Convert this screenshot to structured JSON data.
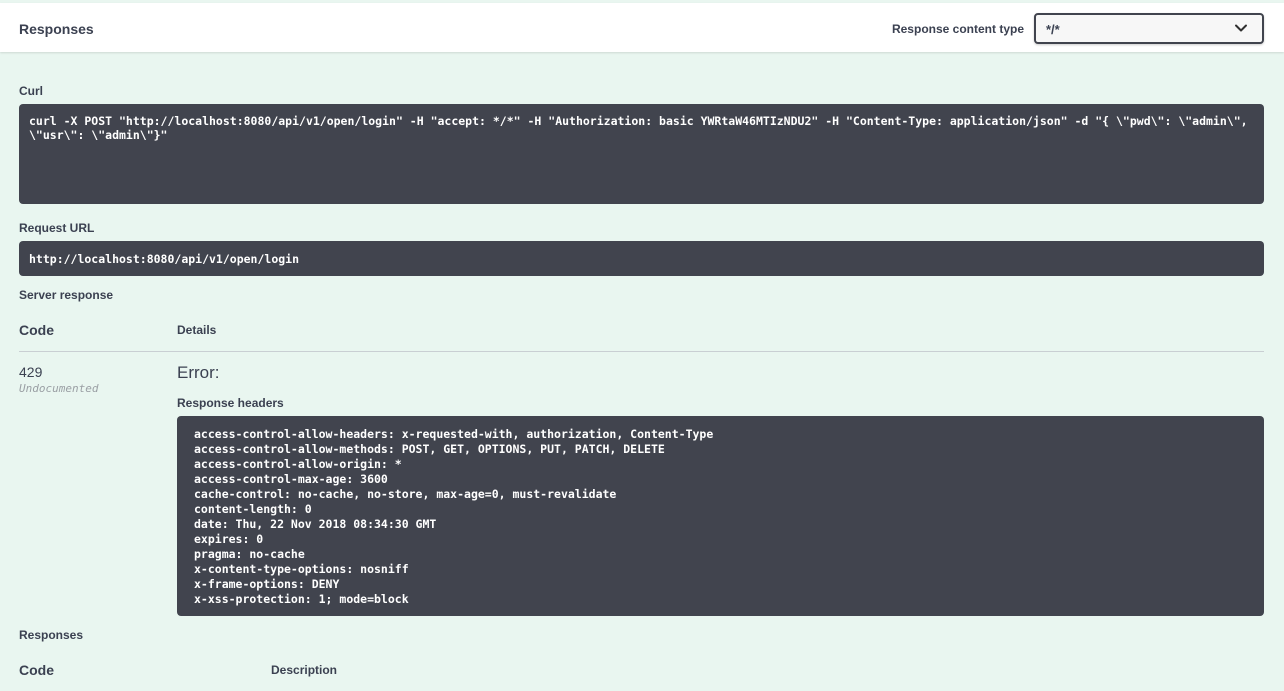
{
  "header": {
    "title": "Responses",
    "content_type_label": "Response content type",
    "content_type_value": "*/*"
  },
  "curl": {
    "label": "Curl",
    "command": "curl -X POST \"http://localhost:8080/api/v1/open/login\" -H \"accept: */*\" -H \"Authorization: basic YWRtaW46MTIzNDU2\" -H \"Content-Type: application/json\" -d \"{ \\\"pwd\\\": \\\"admin\\\", \\\"usr\\\": \\\"admin\\\"}\""
  },
  "request_url": {
    "label": "Request URL",
    "value": "http://localhost:8080/api/v1/open/login"
  },
  "server_response": {
    "label": "Server response",
    "code_header": "Code",
    "details_header": "Details",
    "code": "429",
    "code_note": "Undocumented",
    "error_title": "Error:",
    "headers_label": "Response headers",
    "headers": [
      "access-control-allow-headers: x-requested-with, authorization, Content-Type",
      "access-control-allow-methods: POST, GET, OPTIONS, PUT, PATCH, DELETE",
      "access-control-allow-origin: *",
      "access-control-max-age: 3600",
      "cache-control: no-cache, no-store, max-age=0, must-revalidate",
      "content-length: 0",
      "date: Thu, 22 Nov 2018 08:34:30 GMT",
      "expires: 0",
      "pragma: no-cache",
      "x-content-type-options: nosniff",
      "x-frame-options: DENY",
      "x-xss-protection: 1; mode=block"
    ]
  },
  "responses": {
    "label": "Responses",
    "code_header": "Code",
    "description_header": "Description"
  },
  "colors": {
    "background": "#e9f6f0",
    "code_block": "#41444e",
    "text": "#3b4151"
  },
  "icons": {
    "select": "chevron-down-icon"
  }
}
